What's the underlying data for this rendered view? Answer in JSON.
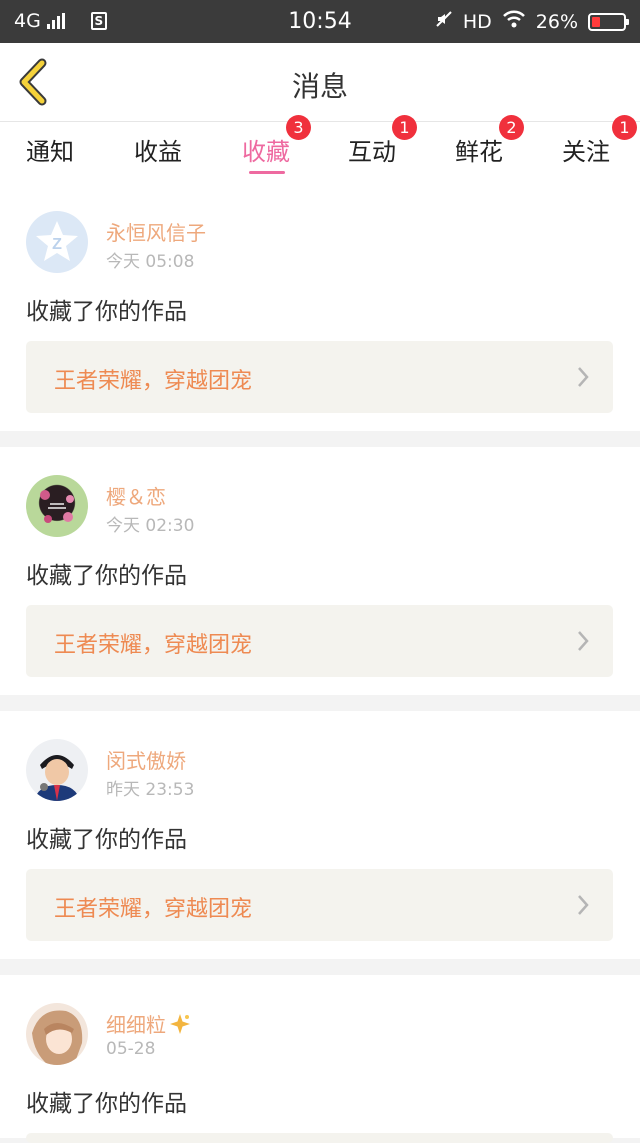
{
  "status_bar": {
    "network": "4G",
    "sim_label": "S",
    "time": "10:54",
    "hd": "HD",
    "battery_percent": "26%",
    "battery_level": 0.26
  },
  "header": {
    "title": "消息"
  },
  "tabs": [
    {
      "label": "通知",
      "badge": ""
    },
    {
      "label": "收益",
      "badge": ""
    },
    {
      "label": "收藏",
      "badge": "3"
    },
    {
      "label": "互动",
      "badge": "1"
    },
    {
      "label": "鲜花",
      "badge": "2"
    },
    {
      "label": "关注",
      "badge": "1"
    }
  ],
  "active_tab": "收藏",
  "messages": [
    {
      "user": "永恒风信子",
      "time": "今天 05:08",
      "action": "收藏了你的作品",
      "work": "王者荣耀，穿越团宠"
    },
    {
      "user": "樱＆恋",
      "time": "今天 02:30",
      "action": "收藏了你的作品",
      "work": "王者荣耀，穿越团宠"
    },
    {
      "user": "闵式傲娇",
      "time": "昨天 23:53",
      "action": "收藏了你的作品",
      "work": "王者荣耀，穿越团宠"
    },
    {
      "user": "细细粒",
      "time": "05-28",
      "action": "收藏了你的作品",
      "work": ""
    }
  ],
  "colors": {
    "accent": "#ee6aa0",
    "badge": "#f0303c",
    "username": "#eea87c",
    "work_title": "#ee8a52",
    "back_icon": "#f5d23a"
  }
}
